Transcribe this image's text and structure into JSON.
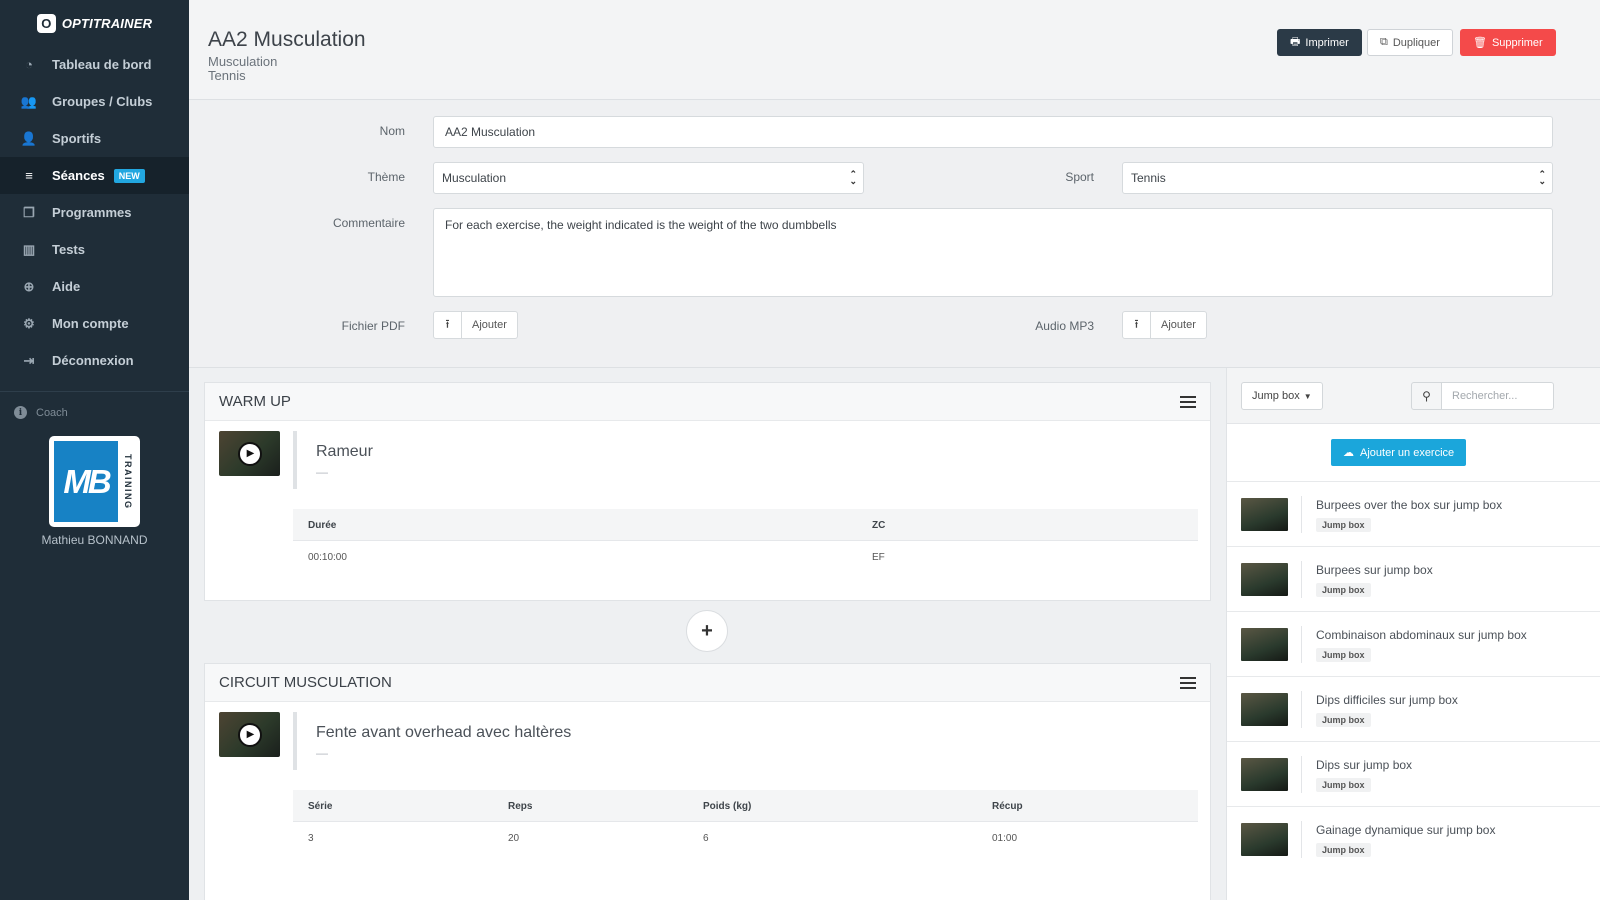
{
  "brand": {
    "name": "OPTITRAINER",
    "mark": "O"
  },
  "sidebar": {
    "items": [
      {
        "label": "Tableau de bord",
        "icon": "dashboard-icon",
        "glyph": "◔"
      },
      {
        "label": "Groupes / Clubs",
        "icon": "users-icon",
        "glyph": "👥"
      },
      {
        "label": "Sportifs",
        "icon": "user-icon",
        "glyph": "👤"
      },
      {
        "label": "Séances",
        "icon": "database-icon",
        "glyph": "≡",
        "badge": "NEW",
        "active": true
      },
      {
        "label": "Programmes",
        "icon": "files-icon",
        "glyph": "❐"
      },
      {
        "label": "Tests",
        "icon": "bar-chart-icon",
        "glyph": "▥"
      },
      {
        "label": "Aide",
        "icon": "lifebuoy-icon",
        "glyph": "⊕"
      },
      {
        "label": "Mon compte",
        "icon": "gear-icon",
        "glyph": "⚙"
      },
      {
        "label": "Déconnexion",
        "icon": "sign-out-icon",
        "glyph": "⇥"
      }
    ],
    "coach_label": "Coach",
    "coach_name": "Mathieu BONNAND",
    "avatar": {
      "monogram": "MB",
      "side_text": "TRAINING"
    }
  },
  "header": {
    "title": "AA2 Musculation",
    "theme": "Musculation",
    "sport": "Tennis",
    "buttons": {
      "print": "Imprimer",
      "duplicate": "Dupliquer",
      "delete": "Supprimer"
    }
  },
  "form": {
    "nom_label": "Nom",
    "nom_value": "AA2 Musculation",
    "theme_label": "Thème",
    "theme_value": "Musculation",
    "sport_label": "Sport",
    "sport_value": "Tennis",
    "comment_label": "Commentaire",
    "comment_value": "For each exercise, the weight indicated is the weight of the two dumbbells",
    "pdf_label": "Fichier PDF",
    "audio_label": "Audio MP3",
    "add_label": "Ajouter"
  },
  "blocks": [
    {
      "title": "WARM UP",
      "exercise": "Rameur",
      "dash": "—",
      "columns": [
        "Durée",
        "ZC"
      ],
      "values": [
        "00:10:00",
        "EF"
      ]
    },
    {
      "title": "CIRCUIT MUSCULATION",
      "exercise": "Fente avant overhead avec haltères",
      "dash": "—",
      "columns": [
        "Série",
        "Reps",
        "Poids (kg)",
        "Récup"
      ],
      "values": [
        "3",
        "20",
        "6",
        "01:00"
      ]
    }
  ],
  "library": {
    "filter": "Jump box",
    "search_placeholder": "Rechercher...",
    "add_button": "Ajouter un exercice",
    "items": [
      {
        "name": "Burpees over the box sur jump box",
        "tag": "Jump box"
      },
      {
        "name": "Burpees sur jump box",
        "tag": "Jump box"
      },
      {
        "name": "Combinaison abdominaux sur jump box",
        "tag": "Jump box"
      },
      {
        "name": "Dips difficiles sur jump box",
        "tag": "Jump box"
      },
      {
        "name": "Dips sur jump box",
        "tag": "Jump box"
      },
      {
        "name": "Gainage dynamique sur jump box",
        "tag": "Jump box"
      }
    ]
  }
}
